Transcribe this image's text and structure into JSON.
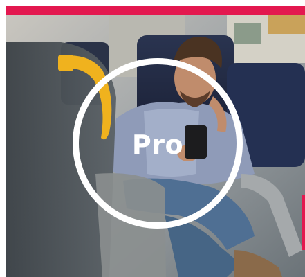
{
  "card": {
    "badge_label": "Pro",
    "accent_color": "#e3184f",
    "image_subject": "man-on-train-using-phone"
  }
}
